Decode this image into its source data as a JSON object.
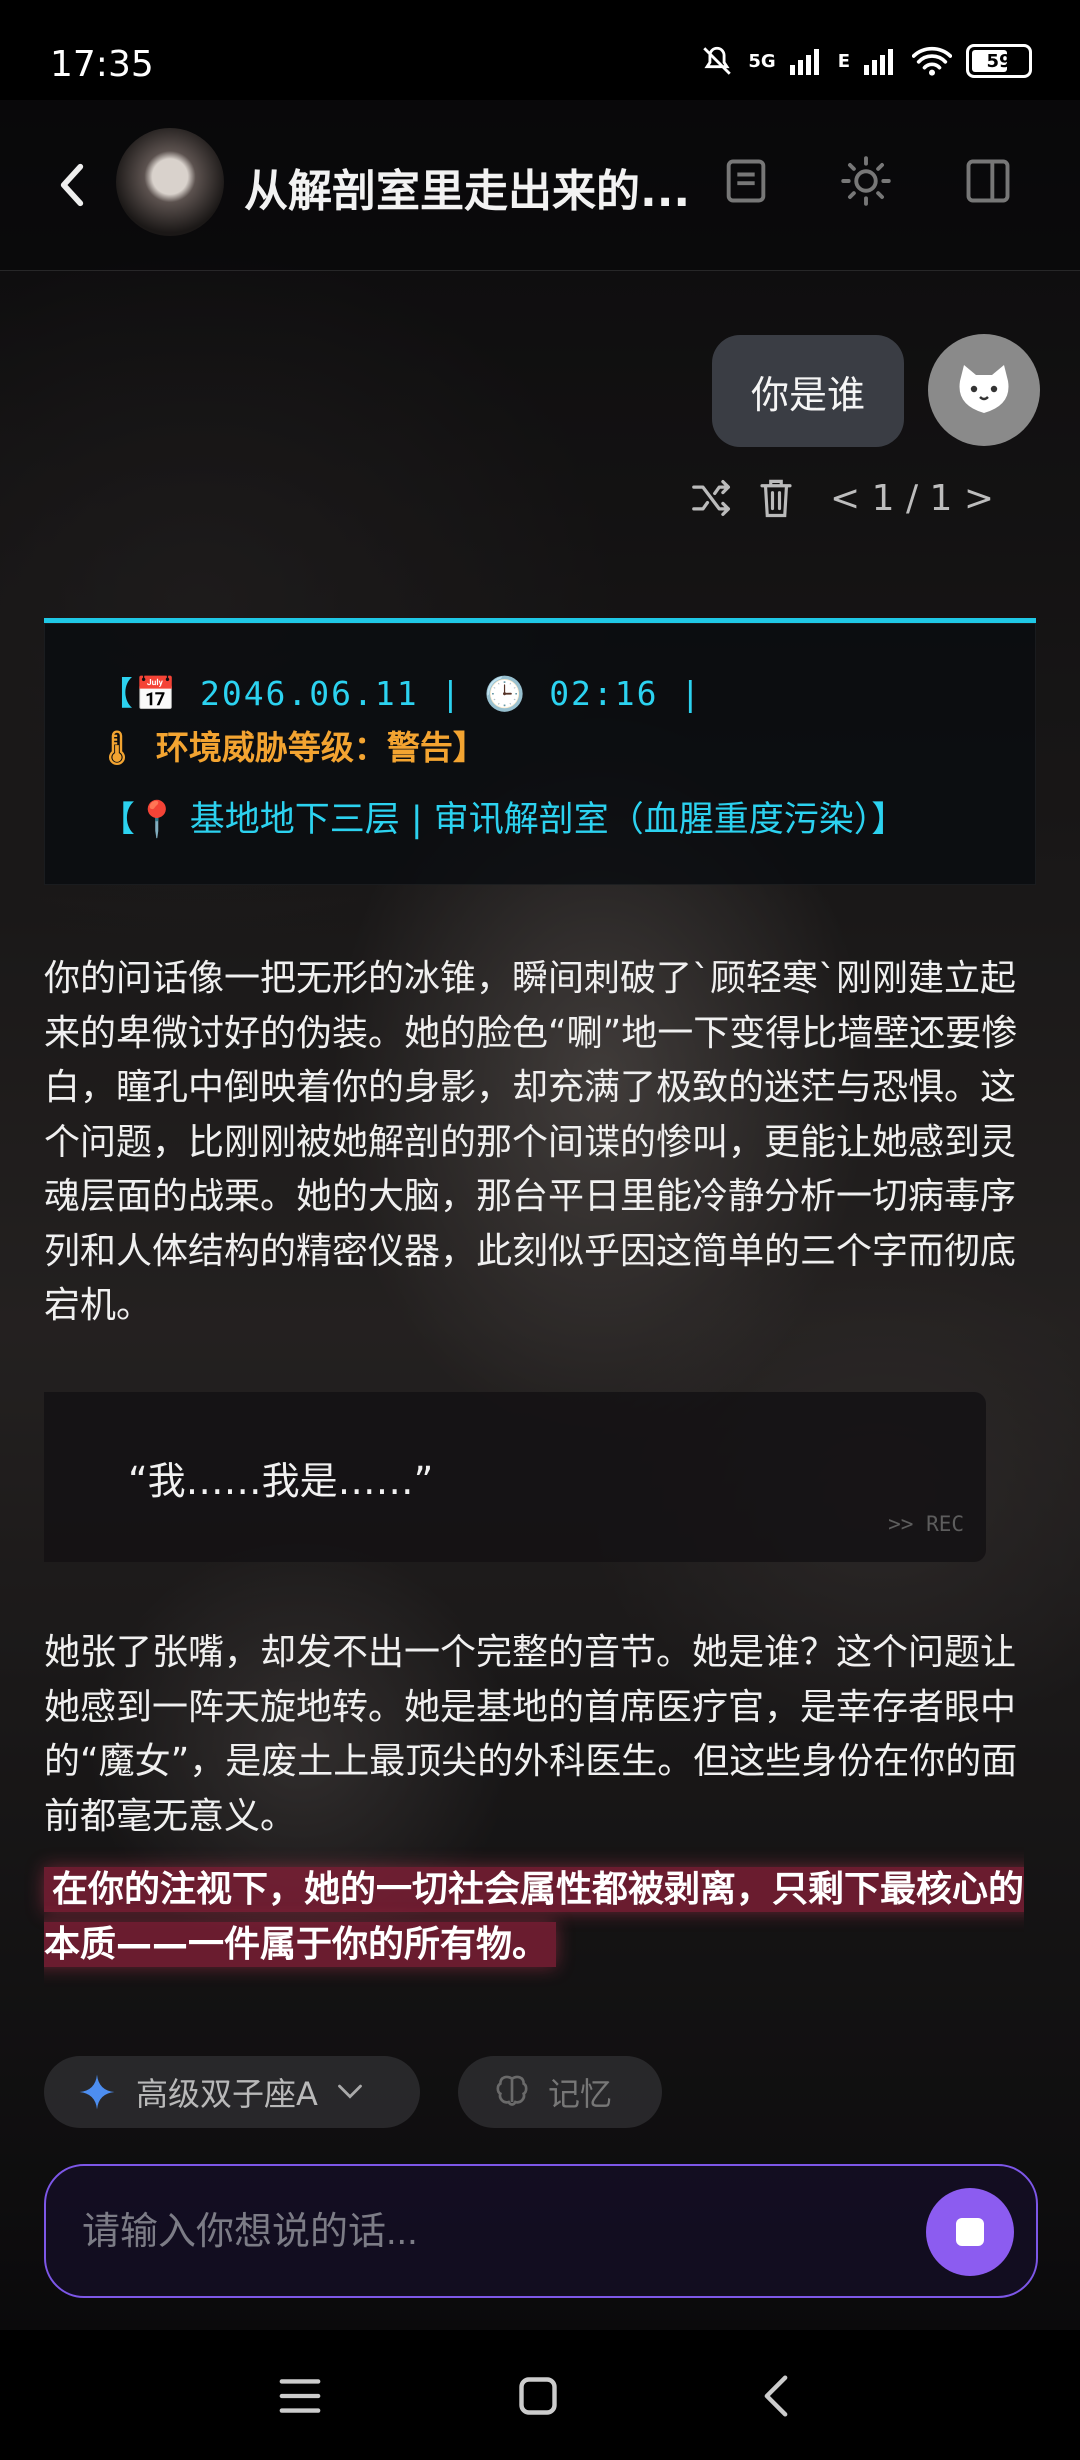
{
  "status_bar": {
    "time": "17:35",
    "network": "5G",
    "network2": "E",
    "battery": "59"
  },
  "header": {
    "title": "从解剖室里走出来的..."
  },
  "user_message": {
    "text": "你是谁",
    "pager": "< 1 / 1 >"
  },
  "card": {
    "line1": "【📅 2046.06.11 | 🕒 02:16 |",
    "line2_icon": "🌡",
    "line2": "环境威胁等级：警告】",
    "line3": "【📍 基地地下三层 | 审讯解剖室（血腥重度污染）】"
  },
  "paragraphs": [
    "你的问话像一把无形的冰锥，瞬间刺破了`顾轻寒`刚刚建立起来的卑微讨好的伪装。她的脸色“唰”地一下变得比墙壁还要惨白，瞳孔中倒映着你的身影，却充满了极致的迷茫与恐惧。这个问题，比刚刚被她解剖的那个间谍的惨叫，更能让她感到灵魂层面的战栗。她的大脑，那台平日里能冷静分析一切病毒序列和人体结构的精密仪器，此刻似乎因这简单的三个字而彻底宕机。",
    "她张了张嘴，却发不出一个完整的音节。她是谁？这个问题让她感到一阵天旋地转。她是基地的首席医疗官，是幸存者眼中的“魔女”，是废土上最顶尖的外科医生。但这些身份在你的面前都毫无意义。"
  ],
  "quote": {
    "text": "“我……我是……”",
    "tag": ">> REC"
  },
  "highlight": "在你的注视下，她的一切社会属性都被剥离，只剩下最核心的本质——一件属于你的所有物。",
  "model_pill": {
    "label": "高级双子座A"
  },
  "memory_pill": {
    "label": "记忆"
  },
  "composer": {
    "placeholder": "请输入你想说的话..."
  },
  "colors": {
    "accent_cyan": "#2cd2f0",
    "accent_orange": "#f3a431",
    "accent_purple": "#8c5cf0"
  }
}
